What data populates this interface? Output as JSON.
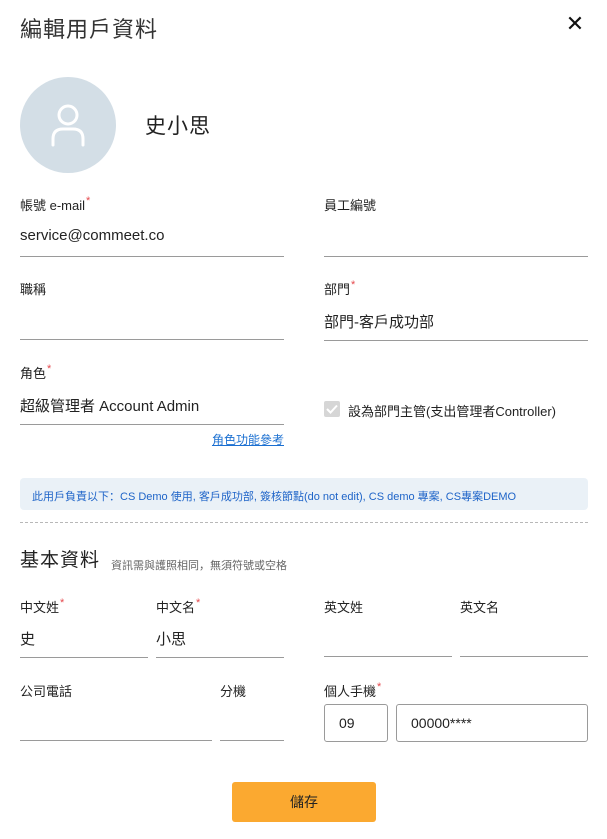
{
  "dialog": {
    "title": "編輯用戶資料",
    "close_icon": "close-icon"
  },
  "profile": {
    "avatar_icon": "user-icon",
    "name": "史小思"
  },
  "fields": {
    "email": {
      "label": "帳號 e-mail",
      "required": "*",
      "value": "service@commeet.co"
    },
    "employee_id": {
      "label": "員工編號",
      "value": ""
    },
    "job_title": {
      "label": "職稱",
      "value": ""
    },
    "department": {
      "label": "部門",
      "required": "*",
      "value": "部門-客戶成功部"
    },
    "role": {
      "label": "角色",
      "required": "*",
      "value": "超級管理者 Account Admin"
    }
  },
  "role_link": "角色功能參考",
  "manager_checkbox": {
    "label": "設為部門主管(支出管理者Controller)",
    "checked": true
  },
  "info_banner": "此用戶負責以下：CS Demo 使用, 客戶成功部, 簽核節點(do not edit), CS demo 專案, CS專案DEMO",
  "basic_section": {
    "title": "基本資料",
    "hint": "資訊需與護照相同，無須符號或空格",
    "last_name_zh": {
      "label": "中文姓",
      "required": "*",
      "value": "史"
    },
    "first_name_zh": {
      "label": "中文名",
      "required": "*",
      "value": "小思"
    },
    "last_name_en": {
      "label": "英文姓",
      "value": ""
    },
    "first_name_en": {
      "label": "英文名",
      "value": ""
    },
    "office_phone": {
      "label": "公司電話",
      "value": ""
    },
    "extension": {
      "label": "分機",
      "value": ""
    },
    "mobile": {
      "label": "個人手機",
      "required": "*",
      "prefix": "09",
      "number": "00000****"
    }
  },
  "save_button": "儲存",
  "colors": {
    "accent": "#fba930",
    "link": "#1a6fd1",
    "banner_bg": "#eaf1f7",
    "required": "#e5484d",
    "avatar_bg": "#d3dee6"
  }
}
